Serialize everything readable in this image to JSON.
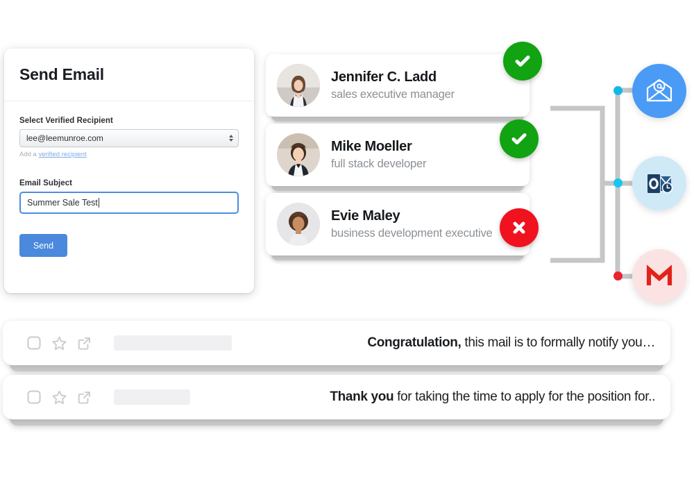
{
  "send_email_card": {
    "title": "Send Email",
    "recipient_label": "Select Verified Recipient",
    "recipient_value": "lee@leemunroe.com",
    "helper_prefix": "Add a ",
    "helper_link": "verified recipient",
    "subject_label": "Email Subject",
    "subject_value": "Summer Sale Test",
    "subject_placeholder": "Email Subject",
    "send_label": "Send",
    "accent_color": "#4a89dc",
    "focus_border_color": "#4a8ddd"
  },
  "contacts": [
    {
      "name": "Jennifer C. Ladd",
      "role": "sales executive manager",
      "status": "verified",
      "status_icon": "check-icon",
      "status_color": "#12a312"
    },
    {
      "name": "Mike Moeller",
      "role": "full stack developer",
      "status": "verified",
      "status_icon": "check-icon",
      "status_color": "#12a312"
    },
    {
      "name": "Evie Maley",
      "role": "business development executive",
      "status": "unverified",
      "status_icon": "close-icon",
      "status_color": "#f0121f"
    }
  ],
  "connectors": {
    "line_color": "#c4c6c8",
    "nodes": [
      {
        "name": "node-top",
        "color": "#12b9e8"
      },
      {
        "name": "node-mid",
        "color": "#17c7ef"
      },
      {
        "name": "node-bottom",
        "color": "#e8242f"
      }
    ],
    "providers": [
      {
        "name": "email-at-icon",
        "label": "Email",
        "circle_color": "#4a9bf5",
        "glyph_color": "#ffffff"
      },
      {
        "name": "outlook-icon",
        "label": "Outlook",
        "circle_color": "#cfe9f7",
        "glyph_color": "#1c3f66"
      },
      {
        "name": "gmail-icon",
        "label": "Gmail",
        "circle_color": "#fbe3e3",
        "glyph_color": "#e2231a"
      }
    ]
  },
  "email_list": {
    "rows": [
      {
        "checkbox_icon": "checkbox-icon",
        "star_icon": "star-icon",
        "open_icon": "external-link-icon",
        "snippet_bold": "Congratulation,",
        "snippet_rest": " this mail is to formally notify you…",
        "redact_width": 170
      },
      {
        "checkbox_icon": "checkbox-icon",
        "star_icon": "star-icon",
        "open_icon": "external-link-icon",
        "snippet_bold": "Thank you",
        "snippet_rest": " for taking the time to apply for the position for..",
        "redact_width": 110
      }
    ]
  }
}
